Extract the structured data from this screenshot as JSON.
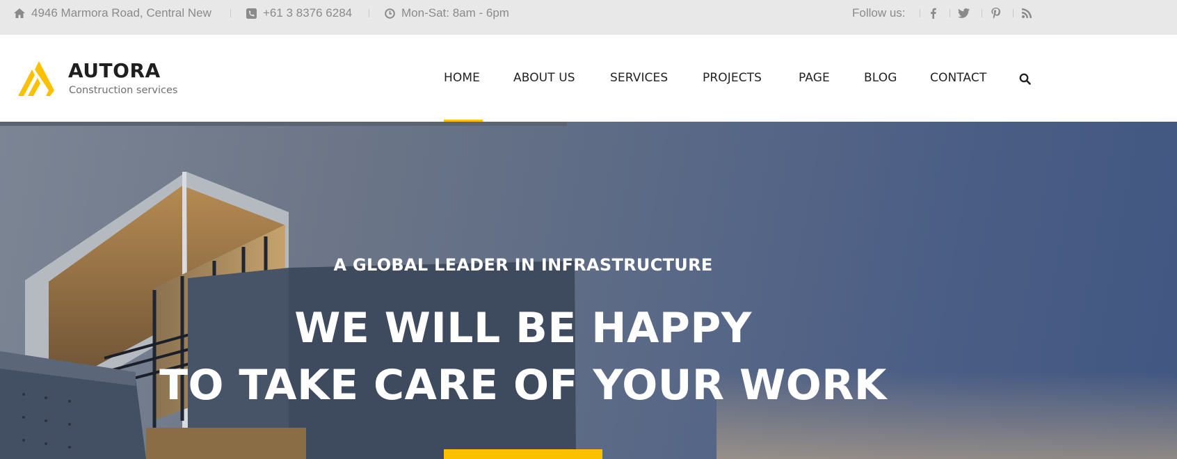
{
  "topbar": {
    "address": "4946 Marmora Road, Central New",
    "phone": "+61 3 8376 6284",
    "hours": "Mon-Sat: 8am - 6pm",
    "follow_label": "Follow us:",
    "icons": [
      "home-icon",
      "phone-icon",
      "clock-icon"
    ],
    "social": [
      "facebook-icon",
      "twitter-icon",
      "pinterest-icon",
      "rss-icon"
    ]
  },
  "header": {
    "brand": "AUTORA",
    "tagline": "Construction services",
    "nav": [
      "HOME",
      "ABOUT US",
      "SERVICES",
      "PROJECTS",
      "PAGE",
      "BLOG",
      "CONTACT"
    ],
    "active_nav": "HOME",
    "accent_color": "#fbc000"
  },
  "hero": {
    "subtitle": "A GLOBAL LEADER IN INFRASTRUCTURE",
    "title_line1": "WE WILL BE HAPPY",
    "title_line2": "TO TAKE CARE OF YOUR WORK"
  }
}
